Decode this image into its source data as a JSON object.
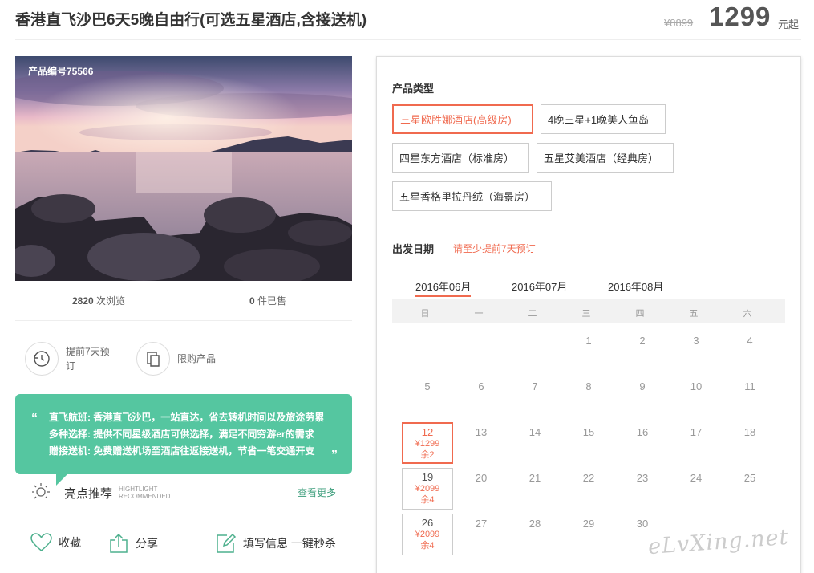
{
  "product": {
    "title": "香港直飞沙巴6天5晚自由行(可选五星酒店,含接送机)",
    "original_price": "¥8899",
    "price": "1299",
    "price_unit": "元起",
    "product_id_label": "产品编号75566"
  },
  "stats": {
    "views_count": "2820",
    "views_label": "次浏览",
    "sold_count": "0",
    "sold_label": "件已售"
  },
  "features": [
    {
      "icon": "clock-icon",
      "label": "提前7天预订"
    },
    {
      "icon": "copy-icon",
      "label": "限购产品"
    }
  ],
  "highlight_box": {
    "rows": [
      {
        "label": "直飞航班:",
        "text": "香港直飞沙巴，一站直达，省去转机时间以及旅途劳累"
      },
      {
        "label": "多种选择:",
        "text": "提供不同星级酒店可供选择，满足不同穷游er的需求"
      },
      {
        "label": "赠接送机:",
        "text": "免费赠送机场至酒店往返接送机，节省一笔交通开支"
      }
    ]
  },
  "highlights": {
    "title": "亮点推荐",
    "en_line1": "HIGHTLIGHT",
    "en_line2": "RECOMMENDED",
    "more": "查看更多"
  },
  "actions": {
    "favorite": "收藏",
    "share": "分享",
    "fill_info": "填写信息 一键秒杀"
  },
  "booking": {
    "type_title": "产品类型",
    "options": [
      "三星欧胜娜酒店(高级房)",
      "4晚三星+1晚美人鱼岛",
      "四星东方酒店（标准房）",
      "五星艾美酒店（经典房）",
      "五星香格里拉丹绒（海景房）"
    ],
    "selected_option": 0,
    "date_title": "出发日期",
    "date_notice": "请至少提前7天预订",
    "months": [
      "2016年06月",
      "2016年07月",
      "2016年08月"
    ],
    "weekdays": [
      "日",
      "一",
      "二",
      "三",
      "四",
      "五",
      "六"
    ],
    "days": {
      "r1": [
        "1",
        "2",
        "3",
        "4"
      ],
      "r2": [
        "5",
        "6",
        "7",
        "8",
        "9",
        "10",
        "11"
      ],
      "r3": [
        "13",
        "14",
        "15",
        "16",
        "17",
        "18"
      ],
      "r4": [
        "20",
        "21",
        "22",
        "23",
        "24",
        "25"
      ],
      "r5": [
        "27",
        "28",
        "29",
        "30"
      ]
    },
    "available": [
      {
        "day": "12",
        "price": "¥1299",
        "left": "余2"
      },
      {
        "day": "19",
        "price": "¥2099",
        "left": "余4"
      },
      {
        "day": "26",
        "price": "¥2099",
        "left": "余4"
      }
    ]
  },
  "watermark": "eLvXing.net",
  "colors": {
    "accent": "#f06a4f",
    "green": "#55c6a0"
  }
}
